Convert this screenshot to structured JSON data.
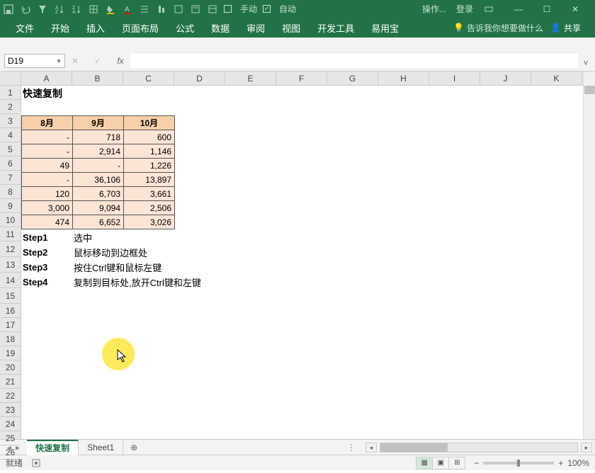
{
  "titlebar": {
    "manual": "手动",
    "auto": "自动",
    "action": "操作...",
    "login": "登录"
  },
  "ribbon": {
    "tabs": [
      "文件",
      "开始",
      "插入",
      "页面布局",
      "公式",
      "数据",
      "审阅",
      "视图",
      "开发工具",
      "易用宝"
    ],
    "tell": "告诉我你想要做什么",
    "share": "共享"
  },
  "formula": {
    "namebox": "D19",
    "fx": "fx"
  },
  "columns": [
    "A",
    "B",
    "C",
    "D",
    "E",
    "F",
    "G",
    "H",
    "I",
    "J",
    "K"
  ],
  "rows": [
    "1",
    "2",
    "3",
    "4",
    "5",
    "6",
    "7",
    "8",
    "9",
    "10",
    "11",
    "12",
    "13",
    "14",
    "15",
    "16",
    "17",
    "18",
    "19",
    "20",
    "21",
    "22",
    "23",
    "24",
    "25",
    "26"
  ],
  "title": "快速复制",
  "table": {
    "headers": [
      "8月",
      "9月",
      "10月"
    ],
    "rows": [
      [
        "-",
        "718",
        "600"
      ],
      [
        "-",
        "2,914",
        "1,146"
      ],
      [
        "49",
        "-",
        "1,226"
      ],
      [
        "-",
        "36,106",
        "13,897"
      ],
      [
        "120",
        "6,703",
        "3,661"
      ],
      [
        "3,000",
        "9,094",
        "2,506"
      ],
      [
        "474",
        "6,652",
        "3,026"
      ]
    ]
  },
  "steps": [
    {
      "label": "Step1",
      "text": "选中"
    },
    {
      "label": "Step2",
      "text": "鼠标移动到边框处"
    },
    {
      "label": "Step3",
      "text": "按住Ctrl键和鼠标左键"
    },
    {
      "label": "Step4",
      "text": "复制到目标处,放开Ctrl键和左键"
    }
  ],
  "sheets": {
    "active": "快速复制",
    "other": "Sheet1"
  },
  "status": {
    "ready": "就绪",
    "zoom": "100%"
  }
}
